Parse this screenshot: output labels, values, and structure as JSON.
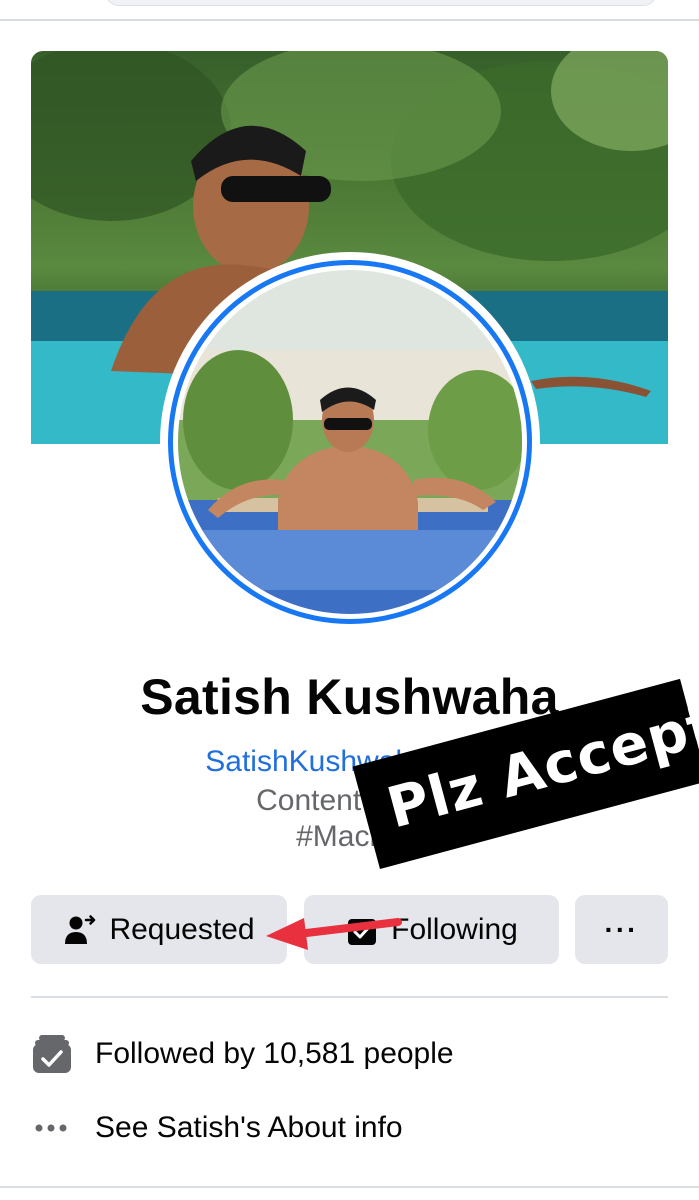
{
  "profile": {
    "name": "Satish Kushwaha",
    "website": "SatishKushwaha.com",
    "bio_line_1": "Content Creat",
    "bio_line_2": "#Macha"
  },
  "overlay": {
    "sticker_text": "Plz Accept",
    "arrow_color": "#e8303f"
  },
  "actions": {
    "requested_label": "Requested",
    "following_label": "Following",
    "more_label": "···"
  },
  "info": {
    "followers_text": "Followed by 10,581 people",
    "about_text": "See Satish's About info"
  },
  "colors": {
    "accent": "#1877f2",
    "link": "#216fdb",
    "button_bg": "#e4e6eb",
    "secondary_text": "#65676b"
  },
  "icons": {
    "requested": "person-arrow-icon",
    "following": "checkbox-icon",
    "more": "more-dots-icon",
    "followers": "followers-stack-icon",
    "about": "ellipsis-icon"
  }
}
